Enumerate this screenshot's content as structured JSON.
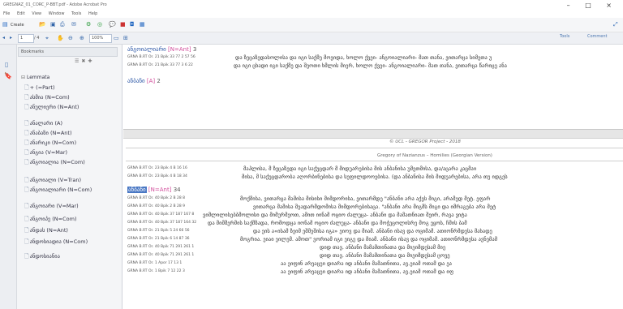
{
  "window": {
    "title": "GREGNAZ_01_CORC_P-BBT.pdf - Adobe Acrobat Pro",
    "controls": [
      "–",
      "□",
      "×"
    ]
  },
  "menu": [
    "File",
    "Edit",
    "View",
    "Window",
    "Tools",
    "Help"
  ],
  "toolbar": {
    "create_label": "Create",
    "page_current": "1",
    "page_total": "/ 4",
    "zoom": "100%",
    "right_tools": "Tools",
    "right_comment": "Comment"
  },
  "left_panel": {
    "header": "Bookmarks",
    "root_label": "Lemmata",
    "items": [
      "+ (=Part)",
      "ასმია (N=Com)",
      "ანულიერი (N=Ant)",
      "ანალარი (A)",
      "ანაბაზი (N=Ant)",
      "ანარიკი (N=Com)",
      "ანგია (V=Mar)",
      "ანგოიალია (N=Com)",
      "ანგოიალი (V=Tran)",
      "ანგოიალიარი (N=Com)",
      "ანგოიარი (V=Mar)",
      "ანგოიპე (N=Com)",
      "ანდას (N=Ant)",
      "ანდოსიადია (N=Com)",
      "ანდოსიანია"
    ]
  },
  "document": {
    "entry1": {
      "lemma": "ანგოიალიარი",
      "pos": "[N=Ant]",
      "count": "3"
    },
    "entry1_refs": [
      "GRNA B.RT Or. 21 Bpik 33 77 2 57 56",
      "GRNA B.RT Or. 21 Bpik 33 77 3 6 22"
    ],
    "entry1_lines": [
      "და ზეცაზედასოლისა და იგი საქმე მოვიდა, ხოლო ქვეი- ანგოიალიარი- მათ თანა, ვითარცა სიმეთა  უ",
      "და იგი ცხადი იგი საქმე და შეოთი ხმლის მიერ, ხოლო ქვეი- ანგოიალიარი- მათ თანა, ვითარცა წარიცე ანა"
    ],
    "entry2": {
      "lemma": "ანბანი",
      "pos": "[A]",
      "count": "2"
    },
    "footer_page": "© UCL - GREGOR Project - 2018",
    "footer_title": "Gregory of Nazianzus – Homilies (Georgian Version)",
    "entry3_refs_a": [
      "GRNA B.RT Or. 23 Bpik 4 B 16 16",
      "GRNA B.RT Or. 23 Bpik 4 B 18 34"
    ],
    "entry3_lines_a": [
      "მაჰლისა, მ ზეცაზედა იგი საქუცდარ მ მიდუარებისა მის  ანბანისა  უმეთმისა, და/აცარა  კაცმაი",
      "მისა, მ საქუცდარობა აღორბინებისა და სეფილდოოებისა. (და  ანბანისა  მის მიდუარებისა, არა თუ იდგეს"
    ],
    "entry4": {
      "lemma": "ანბანი",
      "pos": "[N=Ant]",
      "count": "34"
    },
    "entry4_refs": [
      "GRNA B.RT Or. 40 Bpik 2 B 28 8",
      "GRNA B.RT Or. 40 Bpik 2 B 28 9",
      "GRNA B.RT Or. 40 Bpik 37 187 167 8",
      "GRNA B.RT Or. 40 Bpik 37 187 164 32",
      "GRNA B.RT Or. 21 Bpik 5 24 66 56",
      "GRNA B.RT Or. 21 Bpik 6 14 87 36",
      "GRNA B.RT Or. 40 Bpik 71 291 261 1",
      "GRNA B.RT Or. 40 Bpik 71 291 261 1",
      "GRNA B.RT Or. 1 Apor 17 13 1",
      "GRNA B.RT Or. 1 Bpik 7 12 22 3"
    ],
    "entry4_lines": [
      "მოქმისა, ვითარცა მამისა მისისი მიმდორისა, ვითარმდე  \"ანბანი  არა აქვს მიგი, არამედ მეტ. ეფარ",
      "ვითარცა მამისა შეადარმდომისა მიმდორებისაცა.  \"ანბანი  არა მიგმს მიგი და იმრაგება არა მეტ",
      "ვიმლილისებბმოლისი და მიმურმეოთ, ამით იინამ ოციო ძალუცა-  ანბანი  და მამათნიათ შეირ, რავა ვიტა",
      "და მიმშერმის საქმზადა, რომოდცა იონამ ოციო ძალუცა-  ანბანი  და მოჭეცოლისრე მოგ ეყოს, ჩმის ბამ",
      "და ეის ა«ისამ ზეიმ ეშმეშისა იგა» ეიოვ და მიამ.  ანბანი  ისავ და ოციმამ. ათიონრმდესა  მახადე",
      "მოგრია. ეიაი ეილემ. ამოთ\" ვორიამ იგი ეიგე და მიამ.  ანბანი  ისავ და ოციმამ. ათიონრმდესა ავნემამ",
      "დიდ თავ.  ანბანი  მამამთინათა და მიეიმდესამ მიე",
      "დიდ თავ.  ანბანი  მამამთინათა და მიეიმდესამ ცოვე",
      "აა ეიფინ არეაცეი დიარა იდ  ანბანი  მამათნითა, ავ.ეიამ ოთამ და ეა",
      "აა ეიფინ არეაცეი დიარა იდ  ანბანი  მამათნითა, ავ.ეიამ ოთამ და იფ"
    ]
  }
}
